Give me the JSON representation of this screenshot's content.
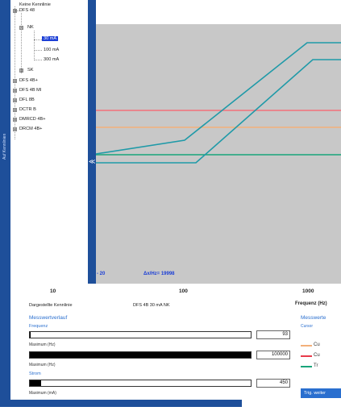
{
  "side_tab": {
    "label": "Auf Kennlinien"
  },
  "tree": {
    "root_label": "Keine Kennlinie",
    "items": [
      {
        "label": "DFS 48",
        "expander": "⊟"
      },
      {
        "label": "NK",
        "expander": "⊟"
      },
      {
        "label": "30 mA",
        "selected": true
      },
      {
        "label": "100 mA"
      },
      {
        "label": "300 mA"
      },
      {
        "label": "SK",
        "expander": "⊞"
      },
      {
        "label": "DFS 4B+",
        "expander": "⊞"
      },
      {
        "label": "DFS 4B MI",
        "expander": "⊞"
      },
      {
        "label": "DFL 8B",
        "expander": "⊞"
      },
      {
        "label": "DCTR B",
        "expander": "⊞"
      },
      {
        "label": "DMRCD 4B+",
        "expander": "⊞"
      },
      {
        "label": "DRCM 4B+",
        "expander": "⊞"
      }
    ]
  },
  "plot": {
    "readout_left": "- 20",
    "readout_right": "Δx/Hz= 19998",
    "x_ticks": [
      "10",
      "100",
      "1000"
    ],
    "x_label": "Frequenz (Hz)",
    "colors": {
      "background": "#c8c8c8",
      "trace_teal": "#1f9aa8",
      "line_red": "#f2707a",
      "line_orange": "#f3b07a",
      "line_green": "#19a57a"
    }
  },
  "info": {
    "dargestellte_label": "Dargestellte Kennlinie",
    "dargestellte_value": "DFS 4B 30 mA NK"
  },
  "messwert": {
    "title": "Messwertverlauf",
    "frequenz_label": "Frequenz",
    "frequenz_value": "93",
    "frequenz_fill": 0.002,
    "max1_label": "Maximum (Hz)",
    "max1_value": "100000",
    "max1_fill": 1.0,
    "max2_label": "Maximum (Hz)",
    "strom_label": "Strom",
    "strom_value": "450",
    "strom_fill": 0.05,
    "max3_label": "Maximum (mA)"
  },
  "right_panel": {
    "title": "Messwerte",
    "subtitle": "Cursor",
    "legend": [
      {
        "label": "Cu",
        "color": "#f3b07a"
      },
      {
        "label": "Cu",
        "color": "#e83a4a"
      },
      {
        "label": "Tr",
        "color": "#19a57a"
      }
    ],
    "button_label": "Trig. weiter"
  }
}
